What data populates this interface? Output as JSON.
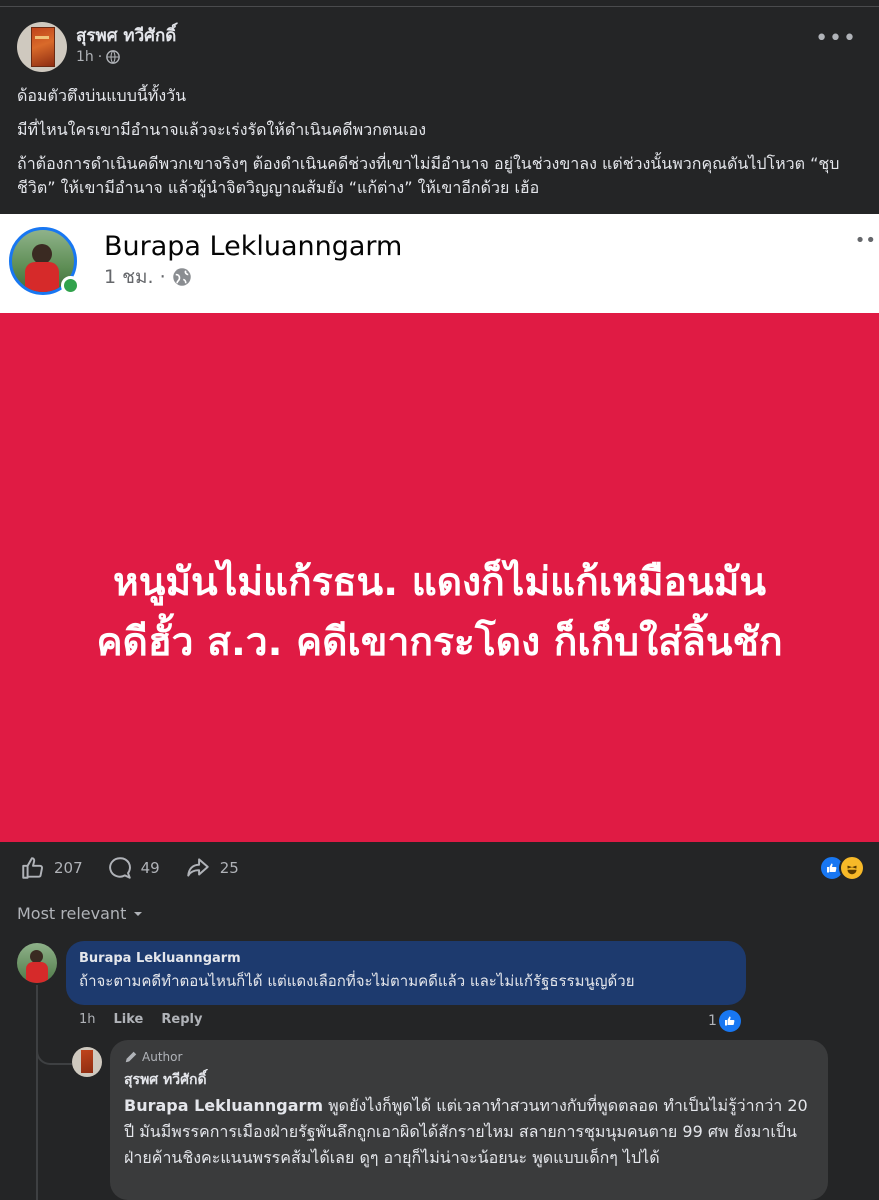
{
  "post": {
    "author": "สุรพศ ทวีศักดิ์",
    "time": "1h",
    "more": "•••",
    "paragraphs": [
      "ด้อมตัวตึงบ่นแบบนี้ทั้งวัน",
      "มีที่ไหนใครเขามีอำนาจแล้วจะเร่งรัดให้ดำเนินคดีพวกตนเอง",
      "ถ้าต้องการดำเนินคดีพวกเขาจริงๆ ต้องดำเนินคดีช่วงที่เขาไม่มีอำนาจ อยู่ในช่วงขาลง แต่ช่วงนั้นพวกคุณดันไปโหวต “ชุบชีวิต” ให้เขามีอำนาจ แล้วผู้นำจิตวิญญาณส้มยัง “แก้ต่าง” ให้เขาอีกด้วย เฮ้อ"
    ]
  },
  "shared": {
    "author": "Burapa Lekluanngarm",
    "time": "1 ชม. ·",
    "more": "••",
    "quote_line1": "หนูมันไม่แก้รธน. แดงก็ไม่แก้เหมือนมัน",
    "quote_line2": "คดีฮั้ว ส.ว. คดีเขากระโดง ก็เก็บใส่ลิ้นชัก",
    "bg_color": "#e01b44"
  },
  "actions": {
    "likes": "207",
    "comments": "49",
    "shares": "25"
  },
  "sort_label": "Most relevant",
  "comment1": {
    "author": "Burapa Lekluanngarm",
    "text": "ถ้าจะตามคดีทำตอนไหนก็ได้ แต่แดงเลือกที่จะไม่ตามคดีแล้ว และไม่แก้รัฐธรรมนูญด้วย",
    "time": "1h",
    "like": "Like",
    "reply": "Reply",
    "reaction_count": "1"
  },
  "comment2": {
    "badge": "Author",
    "author": "สุรพศ ทวีศักดิ์",
    "mention": "Burapa Lekluanngarm",
    "text": " พูดยังไงก็พูดได้ แต่เวลาทำสวนทางกับที่พูดตลอด ทำเป็นไม่รู้ว่ากว่า 20 ปี มันมีพรรคการเมืองฝ่ายรัฐพันลึกถูกเอาผิดได้สักรายไหม สลายการชุมนุมคนตาย 99 ศพ ยังมาเป็นฝ่ายค้านชิงคะแนนพรรคส้มได้เลย ดูๆ อายุก็ไม่น่าจะน้อยนะ พูดแบบเด็กๆ ไปได้"
  }
}
